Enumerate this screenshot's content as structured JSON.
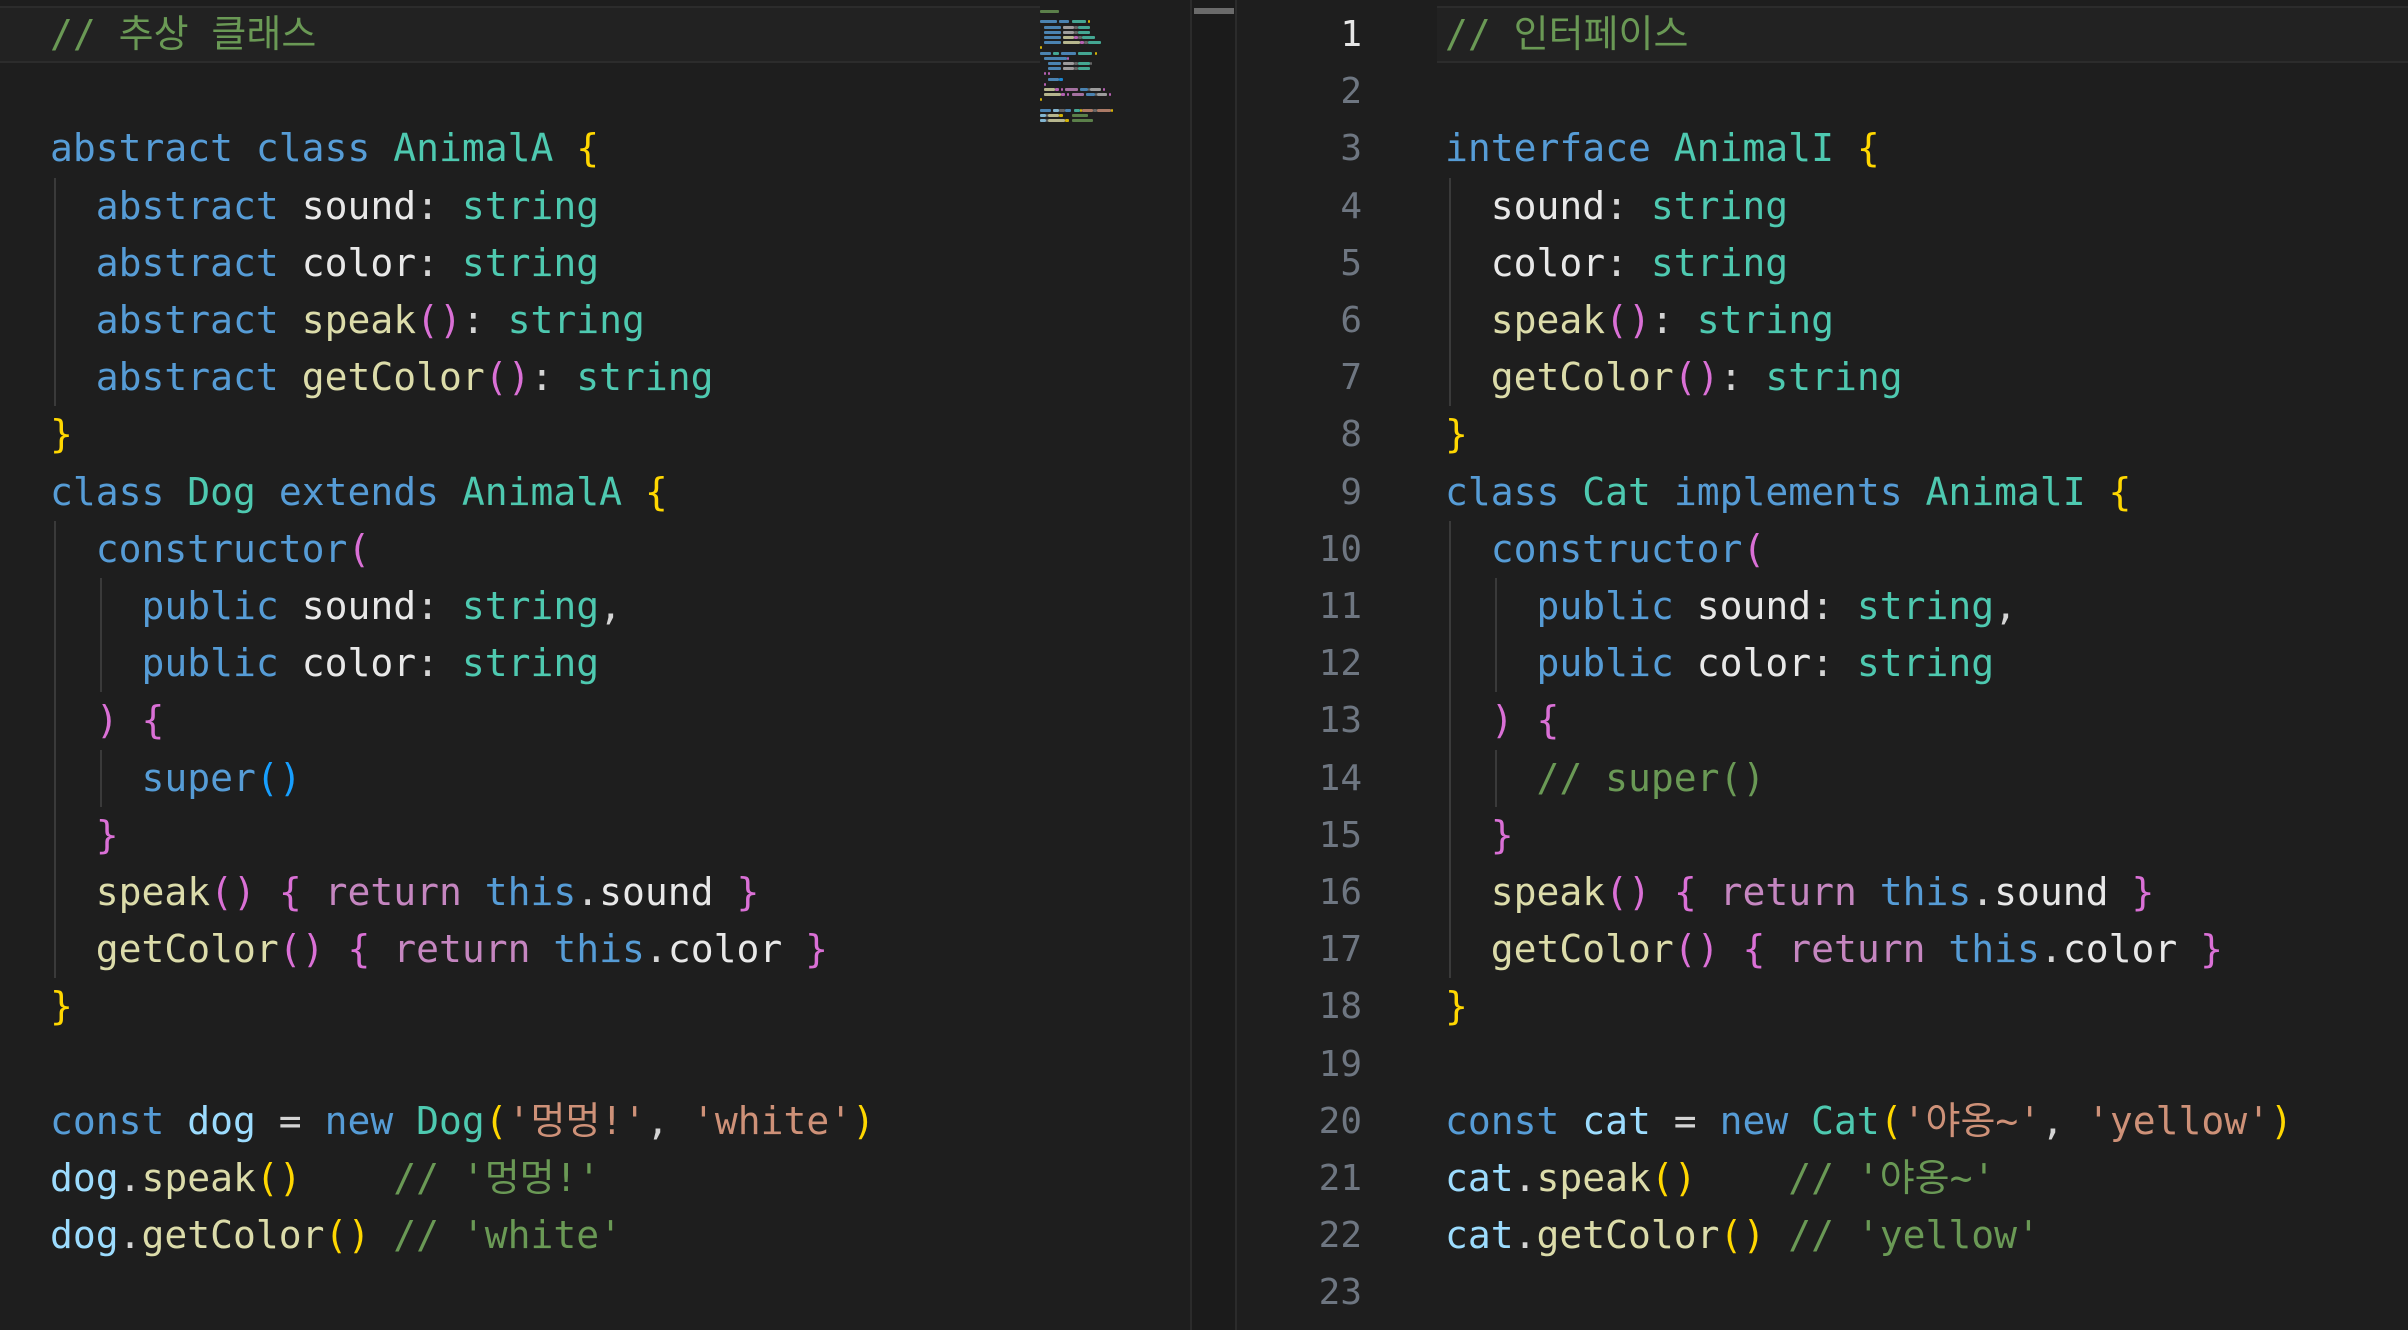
{
  "colors": {
    "background": "#1e1e1e",
    "keyword": "#569cd6",
    "control": "#c586c0",
    "type": "#4ec9b0",
    "function": "#dcdcaa",
    "string": "#ce9178",
    "comment": "#6a9955",
    "bracket_gold": "#ffd700",
    "bracket_purple": "#da70d6",
    "bracket_blue": "#179fff",
    "line_number": "#6e7681"
  },
  "left_editor": {
    "lines": [
      [
        [
          "// 추상 클래스",
          "cm"
        ]
      ],
      [],
      [
        [
          "abstract",
          "kw"
        ],
        [
          " ",
          "pl"
        ],
        [
          "class",
          "kw"
        ],
        [
          " ",
          "pl"
        ],
        [
          "AnimalA",
          "ty"
        ],
        [
          " ",
          "pl"
        ],
        [
          "{",
          "br1"
        ]
      ],
      [
        [
          "  ",
          "pl"
        ],
        [
          "abstract",
          "kw"
        ],
        [
          " ",
          "pl"
        ],
        [
          "sound",
          "wt"
        ],
        [
          ": ",
          "pl"
        ],
        [
          "string",
          "ty"
        ]
      ],
      [
        [
          "  ",
          "pl"
        ],
        [
          "abstract",
          "kw"
        ],
        [
          " ",
          "pl"
        ],
        [
          "color",
          "wt"
        ],
        [
          ": ",
          "pl"
        ],
        [
          "string",
          "ty"
        ]
      ],
      [
        [
          "  ",
          "pl"
        ],
        [
          "abstract",
          "kw"
        ],
        [
          " ",
          "pl"
        ],
        [
          "speak",
          "fn"
        ],
        [
          "()",
          "br2"
        ],
        [
          ": ",
          "pl"
        ],
        [
          "string",
          "ty"
        ]
      ],
      [
        [
          "  ",
          "pl"
        ],
        [
          "abstract",
          "kw"
        ],
        [
          " ",
          "pl"
        ],
        [
          "getColor",
          "fn"
        ],
        [
          "()",
          "br2"
        ],
        [
          ": ",
          "pl"
        ],
        [
          "string",
          "ty"
        ]
      ],
      [
        [
          "}",
          "br1"
        ]
      ],
      [
        [
          "class",
          "kw"
        ],
        [
          " ",
          "pl"
        ],
        [
          "Dog",
          "ty"
        ],
        [
          " ",
          "pl"
        ],
        [
          "extends",
          "kw"
        ],
        [
          " ",
          "pl"
        ],
        [
          "AnimalA",
          "ty"
        ],
        [
          " ",
          "pl"
        ],
        [
          "{",
          "br1"
        ]
      ],
      [
        [
          "  ",
          "pl"
        ],
        [
          "constructor",
          "kw"
        ],
        [
          "(",
          "br2"
        ]
      ],
      [
        [
          "    ",
          "pl"
        ],
        [
          "public",
          "kw"
        ],
        [
          " ",
          "pl"
        ],
        [
          "sound",
          "wt"
        ],
        [
          ": ",
          "pl"
        ],
        [
          "string",
          "ty"
        ],
        [
          ",",
          "pl"
        ]
      ],
      [
        [
          "    ",
          "pl"
        ],
        [
          "public",
          "kw"
        ],
        [
          " ",
          "pl"
        ],
        [
          "color",
          "wt"
        ],
        [
          ": ",
          "pl"
        ],
        [
          "string",
          "ty"
        ]
      ],
      [
        [
          "  ",
          "pl"
        ],
        [
          ")",
          "br2"
        ],
        [
          " ",
          "pl"
        ],
        [
          "{",
          "br2"
        ]
      ],
      [
        [
          "    ",
          "pl"
        ],
        [
          "super",
          "kw"
        ],
        [
          "()",
          "br3"
        ]
      ],
      [
        [
          "  ",
          "pl"
        ],
        [
          "}",
          "br2"
        ]
      ],
      [
        [
          "  ",
          "pl"
        ],
        [
          "speak",
          "fn"
        ],
        [
          "()",
          "br2"
        ],
        [
          " ",
          "pl"
        ],
        [
          "{",
          "br2"
        ],
        [
          " ",
          "pl"
        ],
        [
          "return",
          "ctl"
        ],
        [
          " ",
          "pl"
        ],
        [
          "this",
          "kw"
        ],
        [
          ".",
          "pl"
        ],
        [
          "sound",
          "wt"
        ],
        [
          " ",
          "pl"
        ],
        [
          "}",
          "br2"
        ]
      ],
      [
        [
          "  ",
          "pl"
        ],
        [
          "getColor",
          "fn"
        ],
        [
          "()",
          "br2"
        ],
        [
          " ",
          "pl"
        ],
        [
          "{",
          "br2"
        ],
        [
          " ",
          "pl"
        ],
        [
          "return",
          "ctl"
        ],
        [
          " ",
          "pl"
        ],
        [
          "this",
          "kw"
        ],
        [
          ".",
          "pl"
        ],
        [
          "color",
          "wt"
        ],
        [
          " ",
          "pl"
        ],
        [
          "}",
          "br2"
        ]
      ],
      [
        [
          "}",
          "br1"
        ]
      ],
      [],
      [
        [
          "const",
          "kw"
        ],
        [
          " ",
          "pl"
        ],
        [
          "dog",
          "prop"
        ],
        [
          " = ",
          "pl"
        ],
        [
          "new",
          "kw"
        ],
        [
          " ",
          "pl"
        ],
        [
          "Dog",
          "ty"
        ],
        [
          "(",
          "br1"
        ],
        [
          "'멍멍!'",
          "str"
        ],
        [
          ", ",
          "pl"
        ],
        [
          "'white'",
          "str"
        ],
        [
          ")",
          "br1"
        ]
      ],
      [
        [
          "dog",
          "prop"
        ],
        [
          ".",
          "pl"
        ],
        [
          "speak",
          "fn"
        ],
        [
          "()",
          "br1"
        ],
        [
          "    ",
          "pl"
        ],
        [
          "// '멍멍!'",
          "cm"
        ]
      ],
      [
        [
          "dog",
          "prop"
        ],
        [
          ".",
          "pl"
        ],
        [
          "getColor",
          "fn"
        ],
        [
          "()",
          "br1"
        ],
        [
          " ",
          "pl"
        ],
        [
          "// 'white'",
          "cm"
        ]
      ]
    ]
  },
  "right_editor": {
    "line_numbers": [
      "1",
      "2",
      "3",
      "4",
      "5",
      "6",
      "7",
      "8",
      "9",
      "10",
      "11",
      "12",
      "13",
      "14",
      "15",
      "16",
      "17",
      "18",
      "19",
      "20",
      "21",
      "22",
      "23"
    ],
    "lines": [
      [
        [
          "// 인터페이스",
          "cm"
        ]
      ],
      [],
      [
        [
          "interface",
          "kw"
        ],
        [
          " ",
          "pl"
        ],
        [
          "AnimalI",
          "ty"
        ],
        [
          " ",
          "pl"
        ],
        [
          "{",
          "br1"
        ]
      ],
      [
        [
          "  ",
          "pl"
        ],
        [
          "sound",
          "wt"
        ],
        [
          ": ",
          "pl"
        ],
        [
          "string",
          "ty"
        ]
      ],
      [
        [
          "  ",
          "pl"
        ],
        [
          "color",
          "wt"
        ],
        [
          ": ",
          "pl"
        ],
        [
          "string",
          "ty"
        ]
      ],
      [
        [
          "  ",
          "pl"
        ],
        [
          "speak",
          "fn"
        ],
        [
          "()",
          "br2"
        ],
        [
          ": ",
          "pl"
        ],
        [
          "string",
          "ty"
        ]
      ],
      [
        [
          "  ",
          "pl"
        ],
        [
          "getColor",
          "fn"
        ],
        [
          "()",
          "br2"
        ],
        [
          ": ",
          "pl"
        ],
        [
          "string",
          "ty"
        ]
      ],
      [
        [
          "}",
          "br1"
        ]
      ],
      [
        [
          "class",
          "kw"
        ],
        [
          " ",
          "pl"
        ],
        [
          "Cat",
          "ty"
        ],
        [
          " ",
          "pl"
        ],
        [
          "implements",
          "kw"
        ],
        [
          " ",
          "pl"
        ],
        [
          "AnimalI",
          "ty"
        ],
        [
          " ",
          "pl"
        ],
        [
          "{",
          "br1"
        ]
      ],
      [
        [
          "  ",
          "pl"
        ],
        [
          "constructor",
          "kw"
        ],
        [
          "(",
          "br2"
        ]
      ],
      [
        [
          "    ",
          "pl"
        ],
        [
          "public",
          "kw"
        ],
        [
          " ",
          "pl"
        ],
        [
          "sound",
          "wt"
        ],
        [
          ": ",
          "pl"
        ],
        [
          "string",
          "ty"
        ],
        [
          ",",
          "pl"
        ]
      ],
      [
        [
          "    ",
          "pl"
        ],
        [
          "public",
          "kw"
        ],
        [
          " ",
          "pl"
        ],
        [
          "color",
          "wt"
        ],
        [
          ": ",
          "pl"
        ],
        [
          "string",
          "ty"
        ]
      ],
      [
        [
          "  ",
          "pl"
        ],
        [
          ")",
          "br2"
        ],
        [
          " ",
          "pl"
        ],
        [
          "{",
          "br2"
        ]
      ],
      [
        [
          "    ",
          "pl"
        ],
        [
          "// super()",
          "cm"
        ]
      ],
      [
        [
          "  ",
          "pl"
        ],
        [
          "}",
          "br2"
        ]
      ],
      [
        [
          "  ",
          "pl"
        ],
        [
          "speak",
          "fn"
        ],
        [
          "()",
          "br2"
        ],
        [
          " ",
          "pl"
        ],
        [
          "{",
          "br2"
        ],
        [
          " ",
          "pl"
        ],
        [
          "return",
          "ctl"
        ],
        [
          " ",
          "pl"
        ],
        [
          "this",
          "kw"
        ],
        [
          ".",
          "pl"
        ],
        [
          "sound",
          "wt"
        ],
        [
          " ",
          "pl"
        ],
        [
          "}",
          "br2"
        ]
      ],
      [
        [
          "  ",
          "pl"
        ],
        [
          "getColor",
          "fn"
        ],
        [
          "()",
          "br2"
        ],
        [
          " ",
          "pl"
        ],
        [
          "{",
          "br2"
        ],
        [
          " ",
          "pl"
        ],
        [
          "return",
          "ctl"
        ],
        [
          " ",
          "pl"
        ],
        [
          "this",
          "kw"
        ],
        [
          ".",
          "pl"
        ],
        [
          "color",
          "wt"
        ],
        [
          " ",
          "pl"
        ],
        [
          "}",
          "br2"
        ]
      ],
      [
        [
          "}",
          "br1"
        ]
      ],
      [],
      [
        [
          "const",
          "kw"
        ],
        [
          " ",
          "pl"
        ],
        [
          "cat",
          "prop"
        ],
        [
          " = ",
          "pl"
        ],
        [
          "new",
          "kw"
        ],
        [
          " ",
          "pl"
        ],
        [
          "Cat",
          "ty"
        ],
        [
          "(",
          "br1"
        ],
        [
          "'야옹~'",
          "str"
        ],
        [
          ", ",
          "pl"
        ],
        [
          "'yellow'",
          "str"
        ],
        [
          ")",
          "br1"
        ]
      ],
      [
        [
          "cat",
          "prop"
        ],
        [
          ".",
          "pl"
        ],
        [
          "speak",
          "fn"
        ],
        [
          "()",
          "br1"
        ],
        [
          "    ",
          "pl"
        ],
        [
          "// '야옹~'",
          "cm"
        ]
      ],
      [
        [
          "cat",
          "prop"
        ],
        [
          ".",
          "pl"
        ],
        [
          "getColor",
          "fn"
        ],
        [
          "()",
          "br1"
        ],
        [
          " ",
          "pl"
        ],
        [
          "// 'yellow'",
          "cm"
        ]
      ],
      []
    ]
  }
}
